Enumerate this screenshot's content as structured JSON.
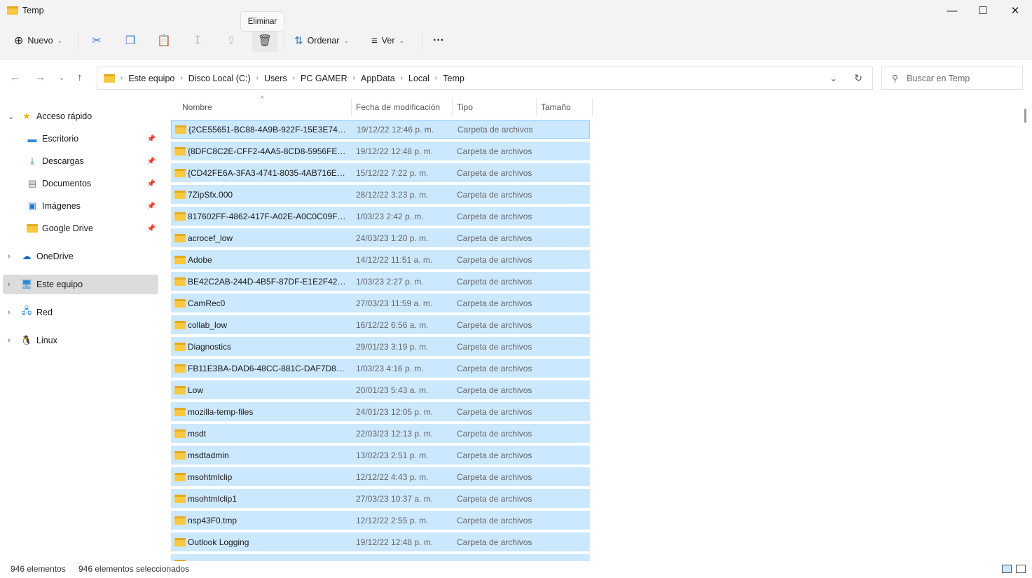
{
  "window": {
    "title": "Temp"
  },
  "toolbar": {
    "new_label": "Nuevo",
    "sort_label": "Ordenar",
    "view_label": "Ver",
    "more": "···",
    "tooltip": "Eliminar"
  },
  "address": {
    "crumbs": [
      "Este equipo",
      "Disco Local (C:)",
      "Users",
      "PC GAMER",
      "AppData",
      "Local",
      "Temp"
    ]
  },
  "search": {
    "placeholder": "Buscar en Temp"
  },
  "sidebar": {
    "quick_access": "Acceso rápido",
    "pinned": [
      {
        "label": "Escritorio",
        "icon": "desktop-icon"
      },
      {
        "label": "Descargas",
        "icon": "download-icon"
      },
      {
        "label": "Documentos",
        "icon": "document-icon"
      },
      {
        "label": "Imágenes",
        "icon": "image-icon"
      },
      {
        "label": "Google Drive",
        "icon": "folder-icon"
      }
    ],
    "roots": [
      {
        "label": "OneDrive",
        "icon": "cloud-icon"
      },
      {
        "label": "Este equipo",
        "icon": "computer-icon"
      },
      {
        "label": "Red",
        "icon": "network-icon"
      },
      {
        "label": "Linux",
        "icon": "linux-icon"
      }
    ]
  },
  "columns": [
    "Nombre",
    "Fecha de modificación",
    "Tipo",
    "Tamaño"
  ],
  "files": [
    {
      "name": "{2CE55651-BC88-4A9B-922F-15E3E74104...",
      "date": "19/12/22 12:46 p. m.",
      "type": "Carpeta de archivos"
    },
    {
      "name": "{8DFC8C2E-CFF2-4AA5-8CD8-5956FED08...",
      "date": "19/12/22 12:48 p. m.",
      "type": "Carpeta de archivos"
    },
    {
      "name": "{CD42FE6A-3FA3-4741-8035-4AB716EAB3...",
      "date": "15/12/22 7:22 p. m.",
      "type": "Carpeta de archivos"
    },
    {
      "name": "7ZipSfx.000",
      "date": "28/12/22 3:23 p. m.",
      "type": "Carpeta de archivos"
    },
    {
      "name": "817602FF-4862-417F-A02E-A0C0C09F6BDE",
      "date": "1/03/23 2:42 p. m.",
      "type": "Carpeta de archivos"
    },
    {
      "name": "acrocef_low",
      "date": "24/03/23 1:20 p. m.",
      "type": "Carpeta de archivos"
    },
    {
      "name": "Adobe",
      "date": "14/12/22 11:51 a. m.",
      "type": "Carpeta de archivos"
    },
    {
      "name": "BE42C2AB-244D-4B5F-87DF-E1E2F4298C42",
      "date": "1/03/23 2:27 p. m.",
      "type": "Carpeta de archivos"
    },
    {
      "name": "CamRec0",
      "date": "27/03/23 11:59 a. m.",
      "type": "Carpeta de archivos"
    },
    {
      "name": "collab_low",
      "date": "16/12/22 6:56 a. m.",
      "type": "Carpeta de archivos"
    },
    {
      "name": "Diagnostics",
      "date": "29/01/23 3:19 p. m.",
      "type": "Carpeta de archivos"
    },
    {
      "name": "FB11E3BA-DAD6-48CC-881C-DAF7D8EC...",
      "date": "1/03/23 4:16 p. m.",
      "type": "Carpeta de archivos"
    },
    {
      "name": "Low",
      "date": "20/01/23 5:43 a. m.",
      "type": "Carpeta de archivos"
    },
    {
      "name": "mozilla-temp-files",
      "date": "24/01/23 12:05 p. m.",
      "type": "Carpeta de archivos"
    },
    {
      "name": "msdt",
      "date": "22/03/23 12:13 p. m.",
      "type": "Carpeta de archivos"
    },
    {
      "name": "msdtadmin",
      "date": "13/02/23 2:51 p. m.",
      "type": "Carpeta de archivos"
    },
    {
      "name": "msohtmlclip",
      "date": "12/12/22 4:43 p. m.",
      "type": "Carpeta de archivos"
    },
    {
      "name": "msohtmlclip1",
      "date": "27/03/23 10:37 a. m.",
      "type": "Carpeta de archivos"
    },
    {
      "name": "nsp43F0.tmp",
      "date": "12/12/22 2:55 p. m.",
      "type": "Carpeta de archivos"
    },
    {
      "name": "Outlook Logging",
      "date": "19/12/22 12:48 p. m.",
      "type": "Carpeta de archivos"
    }
  ],
  "status": {
    "count": "946 elementos",
    "selected": "946 elementos seleccionados"
  },
  "colors": {
    "selection": "#cce8ff",
    "accent": "#0067c0"
  }
}
